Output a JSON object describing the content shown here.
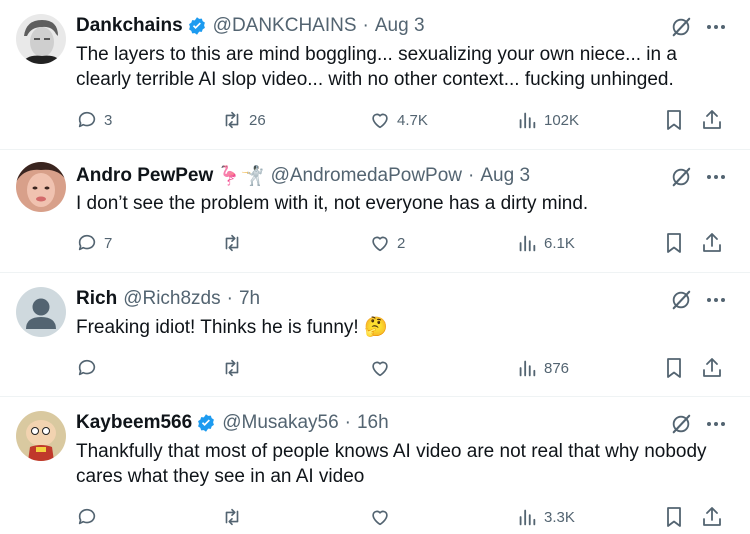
{
  "tweets": [
    {
      "name": "Dankchains",
      "verified": true,
      "handle": "@DANKCHAINS",
      "time": "Aug 3",
      "text": "The layers to this are mind boggling... sexualizing  your own niece... in a clearly terrible AI slop video... with no other context... fucking unhinged.",
      "replies": "3",
      "reposts": "26",
      "likes": "4.7K",
      "views": "102K"
    },
    {
      "name": "Andro PewPew",
      "name_emoji": "🦩🤺",
      "verified": false,
      "handle": "@AndromedaPowPow",
      "time": "Aug 3",
      "text": "I don’t see the problem with it, not everyone has a dirty mind.",
      "replies": "7",
      "reposts": "",
      "likes": "2",
      "views": "6.1K"
    },
    {
      "name": "Rich",
      "verified": false,
      "handle": "@Rich8zds",
      "time": "7h",
      "text": "Freaking idiot! Thinks he is funny! 🤔",
      "replies": "",
      "reposts": "",
      "likes": "",
      "views": "876"
    },
    {
      "name": "Kaybeem566",
      "verified": true,
      "handle": "@Musakay56",
      "time": "16h",
      "text": "Thankfully that most of people knows AI video are not real that why nobody cares what they see in an AI video",
      "replies": "",
      "reposts": "",
      "likes": "",
      "views": "3.3K"
    }
  ],
  "separator": "·",
  "colors": {
    "text": "#0f1419",
    "muted": "#536471",
    "verified": "#1d9bf0",
    "border": "#eff3f4"
  },
  "icons": [
    "verified-badge-icon",
    "grok-icon",
    "more-icon",
    "reply-icon",
    "repost-icon",
    "like-icon",
    "views-icon",
    "bookmark-icon",
    "share-icon"
  ]
}
